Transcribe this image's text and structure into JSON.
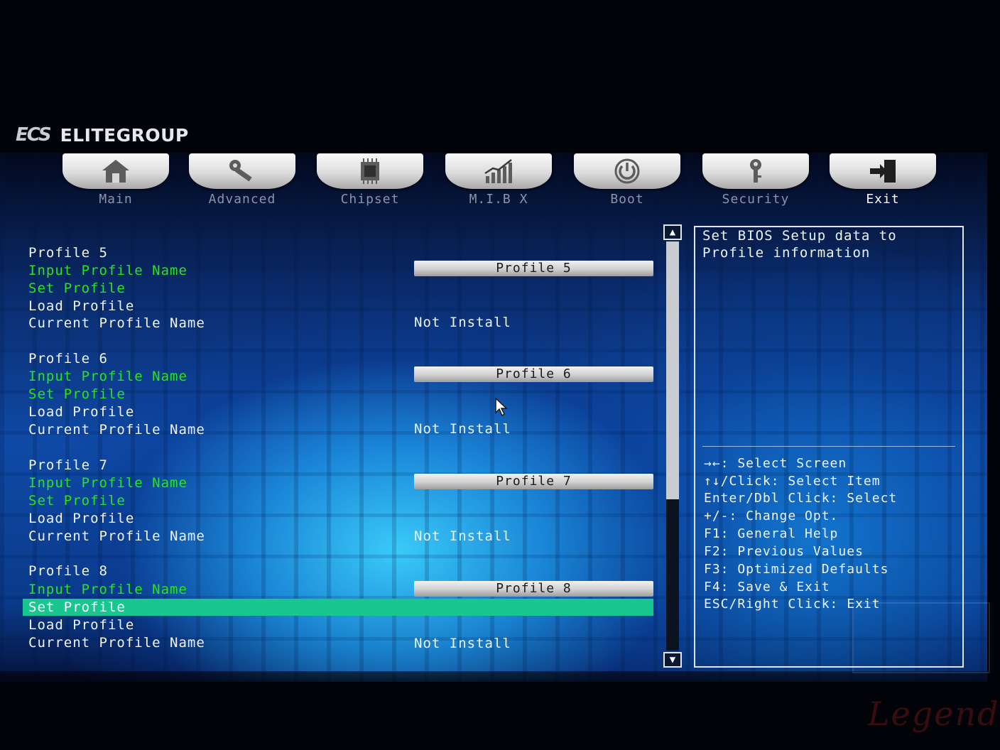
{
  "brand": {
    "logo": "ECS",
    "name": "ELITEGROUP"
  },
  "tabs": [
    {
      "label": "Main",
      "icon": "home-icon",
      "active": false
    },
    {
      "label": "Advanced",
      "icon": "wrench-icon",
      "active": false
    },
    {
      "label": "Chipset",
      "icon": "chip-icon",
      "active": false
    },
    {
      "label": "M.I.B X",
      "icon": "performance-chart-icon",
      "active": false
    },
    {
      "label": "Boot",
      "icon": "power-icon",
      "active": false
    },
    {
      "label": "Security",
      "icon": "key-icon",
      "active": false
    },
    {
      "label": "Exit",
      "icon": "exit-door-icon",
      "active": true
    }
  ],
  "profiles": [
    {
      "heading": "Profile 5",
      "input_label": "Input Profile Name",
      "set_label": "Set Profile",
      "load_label": "Load Profile",
      "current_label": "Current Profile Name",
      "input_value": "Profile 5",
      "current_value": "Not Install"
    },
    {
      "heading": "Profile 6",
      "input_label": "Input Profile Name",
      "set_label": "Set Profile",
      "load_label": "Load Profile",
      "current_label": "Current Profile Name",
      "input_value": "Profile 6",
      "current_value": "Not Install"
    },
    {
      "heading": "Profile 7",
      "input_label": "Input Profile Name",
      "set_label": "Set Profile",
      "load_label": "Load Profile",
      "current_label": "Current Profile Name",
      "input_value": "Profile 7",
      "current_value": "Not Install"
    },
    {
      "heading": "Profile 8",
      "input_label": "Input Profile Name",
      "set_label": "Set Profile",
      "load_label": "Load Profile",
      "current_label": "Current Profile Name",
      "input_value": "Profile 8",
      "current_value": "Not Install"
    }
  ],
  "help": {
    "description_line1": "Set BIOS Setup data to",
    "description_line2": "Profile information",
    "keys": [
      "→←: Select Screen",
      "↑↓/Click: Select Item",
      "Enter/Dbl Click: Select",
      "+/-: Change Opt.",
      "F1: General Help",
      "F2: Previous Values",
      "F3: Optimized Defaults",
      "F4: Save & Exit",
      "ESC/Right Click: Exit"
    ]
  },
  "scrollbar": {
    "up_glyph": "▲",
    "down_glyph": "▼",
    "thumb_fraction": 0.63
  },
  "watermark": {
    "text": "Legend"
  },
  "colors": {
    "accent_green": "#26e61c",
    "selection": "#19c68f",
    "text": "#f2f4f8"
  }
}
